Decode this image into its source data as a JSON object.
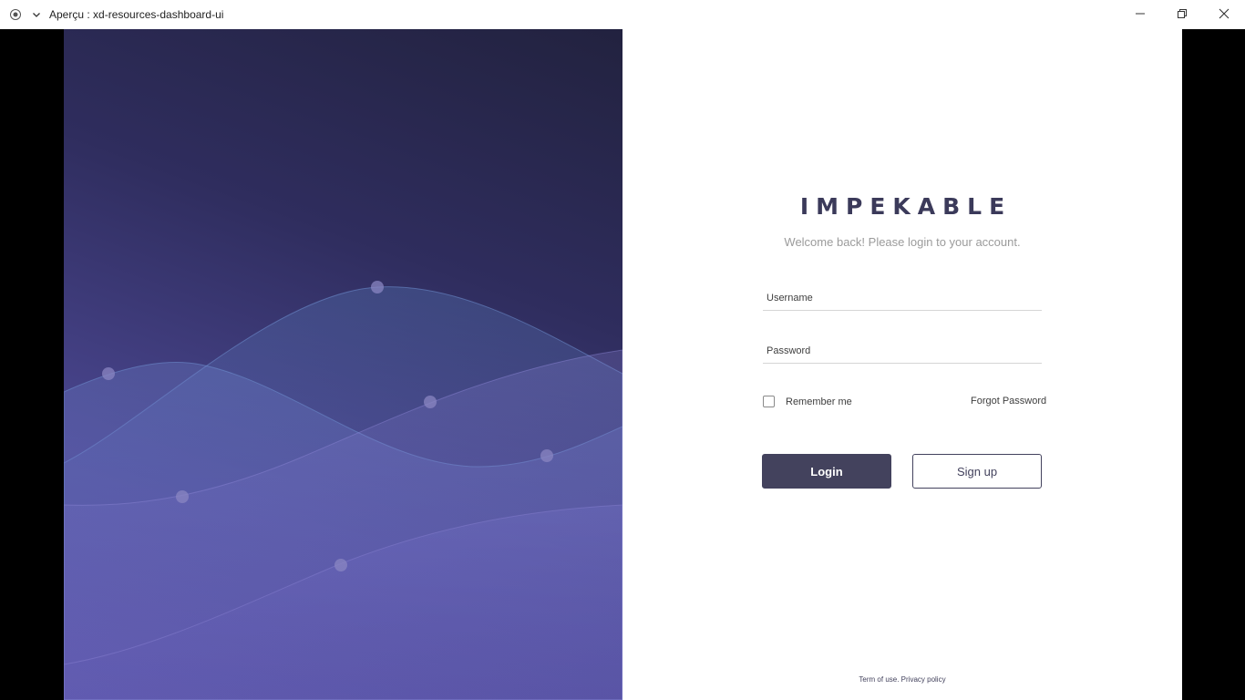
{
  "window": {
    "title": "Aperçu : xd-resources-dashboard-ui",
    "icons": [
      "app-icon",
      "chevron-down-icon",
      "minimize-icon",
      "restore-icon",
      "close-icon"
    ]
  },
  "login": {
    "brand": "IMPEKABLE",
    "welcome": "Welcome back! Please login to your account.",
    "username_placeholder": "Username",
    "password_placeholder": "Password",
    "remember_label": "Remember me",
    "remember_checked": false,
    "forgot_label": "Forgot Password",
    "login_label": "Login",
    "signup_label": "Sign up",
    "footer_terms": "Term of use.",
    "footer_privacy": "Privacy policy"
  },
  "colors": {
    "primary": "#43425d",
    "brand_text": "#3b3a5a",
    "muted_text": "#9b9b9b",
    "panel_gradient": [
      "#22223f",
      "#5b55a8"
    ]
  }
}
